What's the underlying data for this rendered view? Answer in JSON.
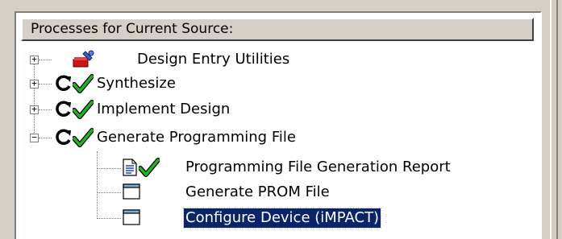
{
  "panel": {
    "header": "Processes for Current Source:"
  },
  "tree": {
    "items": [
      {
        "label": "Design Entry Utilities",
        "expander": "+",
        "status": "none"
      },
      {
        "label": "Synthesize",
        "expander": "+",
        "status": "done"
      },
      {
        "label": "Implement Design",
        "expander": "+",
        "status": "done"
      },
      {
        "label": "Generate Programming File",
        "expander": "−",
        "status": "done"
      },
      {
        "label": "Programming File Generation Report",
        "expander": "",
        "status": "done"
      },
      {
        "label": "Generate PROM File",
        "expander": "",
        "status": "none"
      },
      {
        "label": "Configure Device (iMPACT)",
        "expander": "",
        "status": "none",
        "selected": true
      }
    ]
  },
  "colors": {
    "selection": "#0a246a",
    "check": "#22b422"
  }
}
